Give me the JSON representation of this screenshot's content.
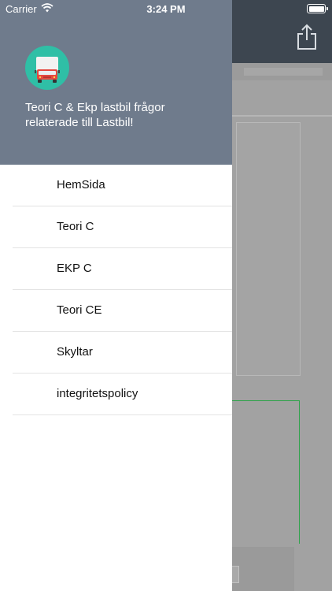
{
  "status_bar": {
    "carrier": "Carrier",
    "time": "3:24 PM"
  },
  "drawer": {
    "description": "Teori C & Ekp lastbil frågor relaterade till Lastbil!",
    "menu_items": [
      {
        "label": "HemSida"
      },
      {
        "label": "Teori C"
      },
      {
        "label": "EKP C"
      },
      {
        "label": "Teori CE"
      },
      {
        "label": "Skyltar"
      },
      {
        "label": "integritetspolicy"
      }
    ]
  },
  "icons": {
    "logo": "truck-icon",
    "share": "share-icon",
    "wifi": "wifi-icon",
    "battery": "battery-icon"
  },
  "colors": {
    "drawer_header": "#6f7b8c",
    "logo_background": "#2fbfa6",
    "background_nav": "#3d4650",
    "accent_green": "#2ea34a"
  }
}
